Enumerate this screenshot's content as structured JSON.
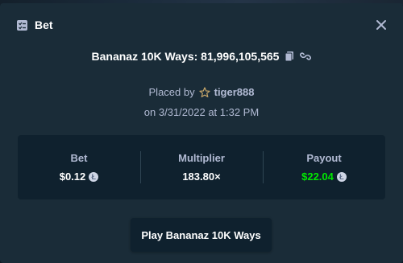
{
  "modal": {
    "title": "Bet",
    "icons": {
      "title": "bet-slip-icon",
      "close": "close-icon"
    }
  },
  "game": {
    "title": "Bananaz 10K Ways: 81,996,105,565",
    "icons": {
      "copy": "copy-icon",
      "link": "link-icon"
    }
  },
  "placed": {
    "prefix": "Placed by",
    "username": "tiger888",
    "date": "on 3/31/2022 at 1:32 PM",
    "icons": {
      "rank": "star-icon"
    }
  },
  "stats": {
    "bet": {
      "label": "Bet",
      "value": "$0.12",
      "currency_icon": "litecoin-icon"
    },
    "multiplier": {
      "label": "Multiplier",
      "value": "183.80×"
    },
    "payout": {
      "label": "Payout",
      "value": "$22.04",
      "currency_icon": "litecoin-icon"
    }
  },
  "actions": {
    "play_label": "Play Bananaz 10K Ways"
  },
  "colors": {
    "modal_bg": "#1a2c38",
    "panel_bg": "#0f212e",
    "muted_text": "#b1bad3",
    "payout_green": "#00e701"
  }
}
